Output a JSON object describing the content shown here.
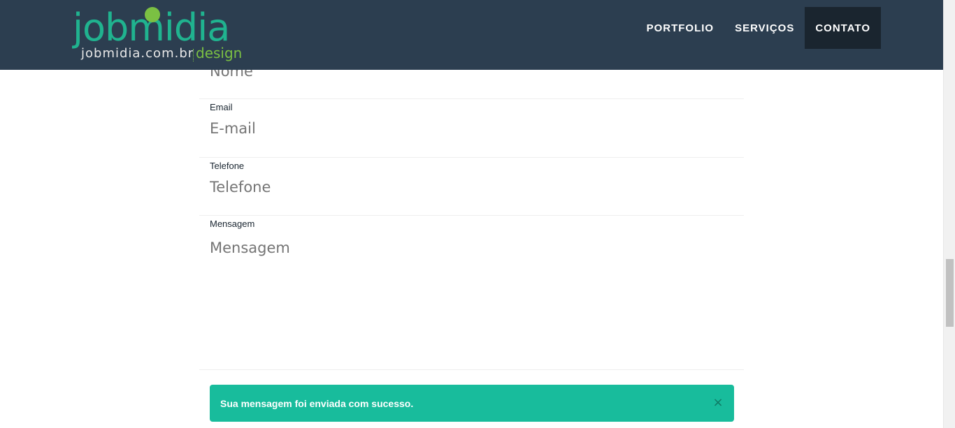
{
  "brand": {
    "name": "jobmidia",
    "domain": "jobmidia.com.br",
    "tagline": "design",
    "colors": {
      "green": "#20b38f",
      "lime": "#7bc043"
    }
  },
  "nav": {
    "items": [
      {
        "label": "PORTFOLIO",
        "active": false
      },
      {
        "label": "SERVIÇOS",
        "active": false
      },
      {
        "label": "CONTATO",
        "active": true
      }
    ]
  },
  "form": {
    "name": {
      "placeholder": "Nome"
    },
    "email": {
      "label": "Email",
      "placeholder": "E-mail"
    },
    "phone": {
      "label": "Telefone",
      "placeholder": "Telefone"
    },
    "message": {
      "label": "Mensagem",
      "placeholder": "Mensagem"
    }
  },
  "alert": {
    "text": "Sua mensagem foi enviada com sucesso.",
    "close": "×",
    "color": "#18bc9c"
  },
  "colors": {
    "navbar": "#2c3e50",
    "active_nav": "#1a252f"
  }
}
